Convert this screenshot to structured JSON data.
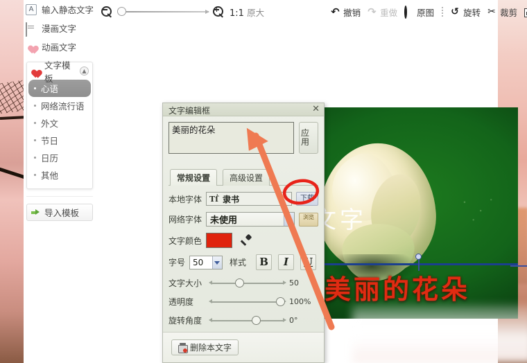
{
  "toolbar": {
    "zoom_out_icon": "magnifier-minus-icon",
    "zoom_in_icon": "magnifier-plus-icon",
    "ratio_value": "1:1",
    "ratio_suffix": "原大",
    "items": [
      {
        "label": "撤销",
        "icon": "undo-icon",
        "disabled": false
      },
      {
        "label": "重做",
        "icon": "redo-icon",
        "disabled": true
      },
      {
        "label": "原图",
        "icon": "original-circle-icon",
        "disabled": false
      },
      {
        "label": "旋转",
        "icon": "rotate-icon",
        "disabled": false
      },
      {
        "label": "裁剪",
        "icon": "scissors-icon",
        "disabled": false
      }
    ],
    "frame_icon": "image-frame-icon"
  },
  "sidebar": {
    "menu": [
      {
        "label": "输入静态文字",
        "icon": "letter-a-box-icon"
      },
      {
        "label": "漫画文字",
        "icon": "speech-bubble-icon"
      },
      {
        "label": "动画文字",
        "icon": "pink-heart-icon"
      }
    ],
    "template_panel": {
      "title": "文字模板",
      "icon": "red-heart-icon",
      "collapse_icon": "chevron-up-icon",
      "items": [
        {
          "label": "心语",
          "active": true
        },
        {
          "label": "网络流行语",
          "active": false
        },
        {
          "label": "外文",
          "active": false
        },
        {
          "label": "节日",
          "active": false
        },
        {
          "label": "日历",
          "active": false
        },
        {
          "label": "其他",
          "active": false
        }
      ]
    },
    "import_button": {
      "label": "导入模板",
      "icon": "import-arrow-icon"
    }
  },
  "dialog": {
    "title": "文字编辑框",
    "close_icon": "close-icon",
    "text_value": "美丽的花朵",
    "apply_label": "应用",
    "tabs": [
      {
        "label": "常规设置",
        "active": true
      },
      {
        "label": "高级设置",
        "active": false
      }
    ],
    "local_font": {
      "label": "本地字体",
      "value": "隶书",
      "glyph_icon": "truetype-font-icon",
      "browse_label": "下载"
    },
    "web_font": {
      "label": "网络字体",
      "value": "未使用",
      "more_label": "浏览"
    },
    "text_color": {
      "label": "文字颜色",
      "value": "#e0230d",
      "picker_icon": "eyedropper-icon"
    },
    "font_size": {
      "label": "字号",
      "value": "50",
      "style_label": "样式",
      "bold": "B",
      "italic": "I",
      "underline": "U"
    },
    "sliders": [
      {
        "label": "文字大小",
        "value": "50",
        "percent": 38
      },
      {
        "label": "透明度",
        "value": "100%",
        "percent": 96
      },
      {
        "label": "旋转角度",
        "value": "0°",
        "percent": 60
      }
    ],
    "delete_button": {
      "label": "删除本文字",
      "icon": "trash-icon"
    }
  },
  "canvas": {
    "watermark": "请输入文字",
    "overlay_text": "美丽的花朵",
    "overlay_color": "#e02b12"
  },
  "annotations": {
    "ellipse_color": "#e8231a",
    "arrow_color": "#ef7a52"
  }
}
